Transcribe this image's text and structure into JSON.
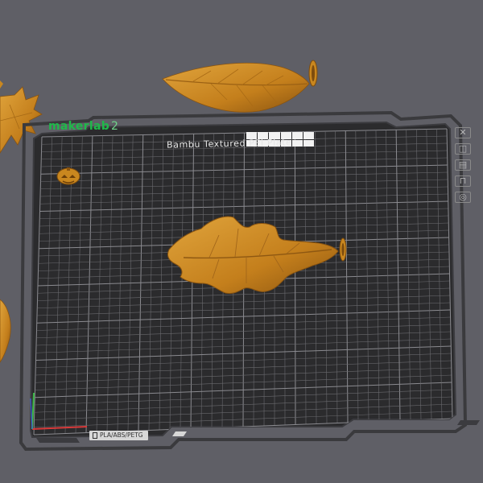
{
  "brand": {
    "name": "makerlab",
    "version": "2"
  },
  "plate": {
    "title": "Bambu Textured PEI Plate",
    "filament_tag": "PLA/ABS/PETG"
  },
  "toolbar": {
    "close": "✕",
    "items": [
      {
        "name": "camera-icon",
        "glyph": "📷"
      },
      {
        "name": "layers-icon",
        "glyph": "☰"
      },
      {
        "name": "lock-icon",
        "glyph": "🔒"
      },
      {
        "name": "settings-icon",
        "glyph": "⚙"
      }
    ]
  },
  "colors": {
    "background": "#5f5f66",
    "plate": "#2c2c2e",
    "grid": "#7a7a7e",
    "model": "#c9871f",
    "brand": "#1fb94a"
  }
}
